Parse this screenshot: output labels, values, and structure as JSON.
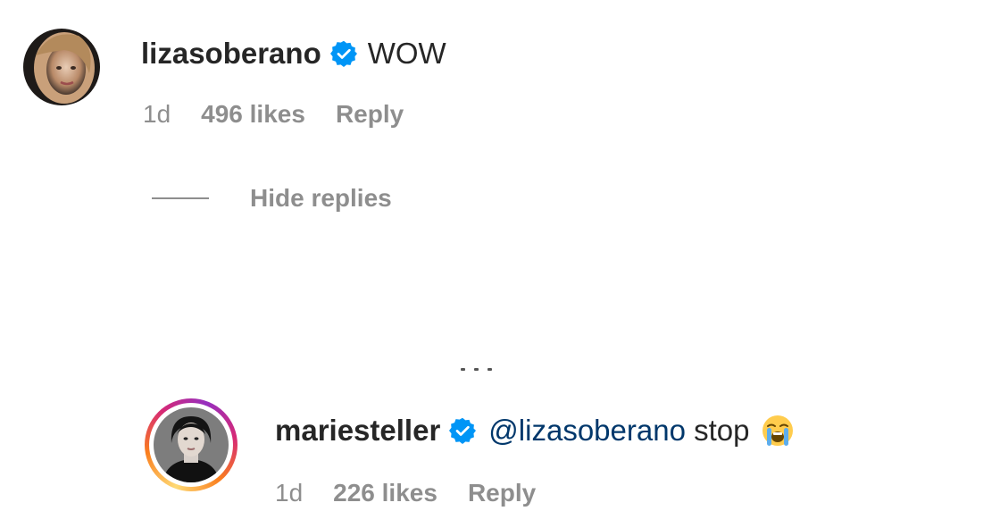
{
  "comments": [
    {
      "username": "lizasoberano",
      "verified": true,
      "text": "WOW",
      "time": "1d",
      "likes": "496 likes",
      "reply_label": "Reply"
    },
    {
      "username": "mariesteller",
      "verified": true,
      "mention": "@lizasoberano",
      "text": " stop",
      "emoji": "loudly-crying-face",
      "time": "1d",
      "likes": "226 likes",
      "reply_label": "Reply",
      "has_story_ring": true
    }
  ],
  "thread": {
    "hide_replies_label": "Hide replies"
  },
  "colors": {
    "verified_blue": "#0095f6",
    "meta_gray": "#8e8e8e",
    "text_dark": "#262626",
    "story_ring_start": "#feda75",
    "story_ring_end": "#d62976"
  }
}
